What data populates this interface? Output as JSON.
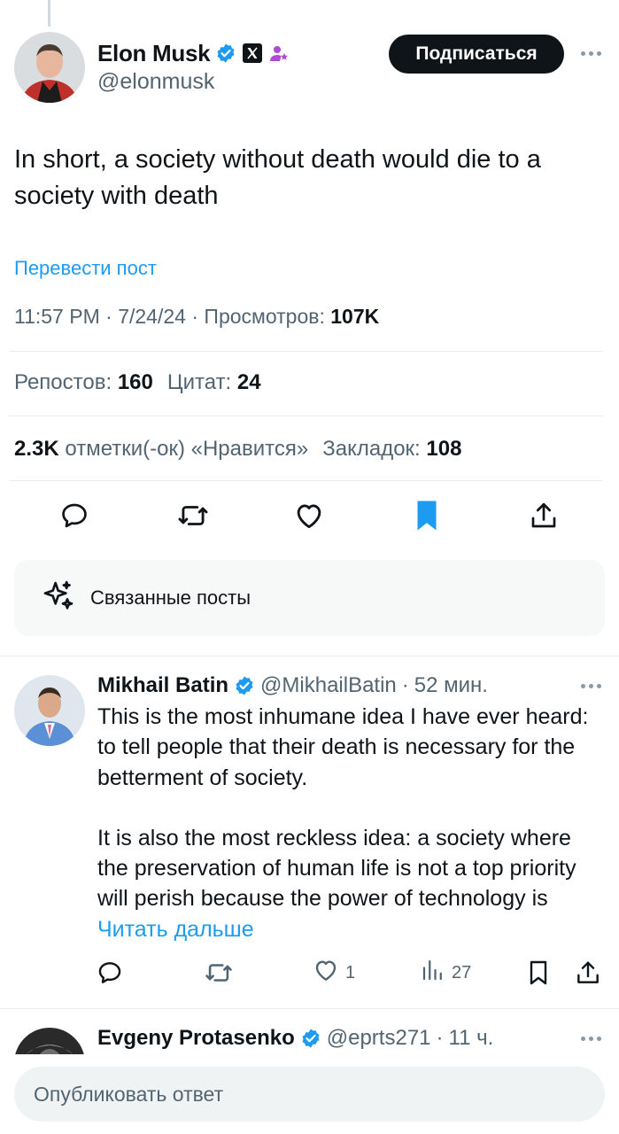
{
  "main_tweet": {
    "author_name": "Elon Musk",
    "author_handle": "@elonmusk",
    "subscribe_label": "Подписаться",
    "text": "In short, a society without death would die to a society with death",
    "translate_label": "Перевести пост",
    "time": "11:57 PM",
    "date": "7/24/24",
    "views_label": "Просмотров:",
    "views_value": "107K",
    "reposts_label": "Репостов:",
    "reposts_value": "160",
    "quotes_label": "Цитат:",
    "quotes_value": "24",
    "likes_value": "2.3K",
    "likes_label": "отметки(-ок) «Нравится»",
    "bookmarks_label": "Закладок:",
    "bookmarks_value": "108"
  },
  "related": {
    "label": "Связанные посты"
  },
  "replies": [
    {
      "author_name": "Mikhail Batin",
      "author_handle": "@MikhailBatin",
      "time": "52 мин.",
      "paragraph1": "This is the most inhumane idea I have ever heard: to tell people that their death is necessary for the betterment of society.",
      "paragraph2": "It is also the most reckless idea: a society where the preservation of human life is not a top priority will perish because the power of technology is",
      "read_more": "Читать дальше",
      "likes": "1",
      "views": "27"
    },
    {
      "author_name": "Evgeny Protasenko",
      "author_handle": "@eprts271",
      "time": "11 ч."
    }
  ],
  "compose": {
    "placeholder": "Опубликовать ответ"
  },
  "colors": {
    "accent": "#1d9bf0",
    "text": "#0f1419",
    "secondary": "#536471",
    "verified": "#1d9bf0"
  }
}
